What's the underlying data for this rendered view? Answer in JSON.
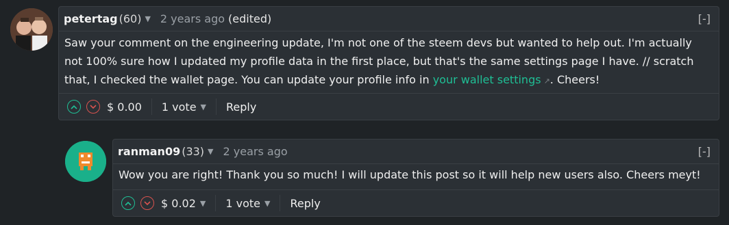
{
  "comments": [
    {
      "author": "petertag",
      "reputation": "(60)",
      "time": "2 years ago",
      "edited": "(edited)",
      "collapse": "[-]",
      "text_before_link": "Saw your comment on the engineering update, I'm not one of the steem devs but wanted to help out. I'm actually not 100% sure how I updated my profile data in the first place, but that's the same settings page I have. // scratch that, I checked the wallet page. You can update your profile info in ",
      "link_text": "your wallet settings",
      "text_after_link": ". Cheers!",
      "payout": "$ 0.00",
      "votes": "1 vote",
      "reply": "Reply"
    },
    {
      "author": "ranman09",
      "reputation": "(33)",
      "time": "2 years ago",
      "collapse": "[-]",
      "text": "Wow you are right! Thank you so much! I will update this post so it will help new users also. Cheers meyt!",
      "payout": "$ 0.02",
      "votes": "1 vote",
      "reply": "Reply"
    }
  ],
  "colors": {
    "background": "#1f2326",
    "card": "#2b3035",
    "link": "#1fbf95",
    "upvote": "#1fbf95",
    "downvote": "#d9534f"
  }
}
